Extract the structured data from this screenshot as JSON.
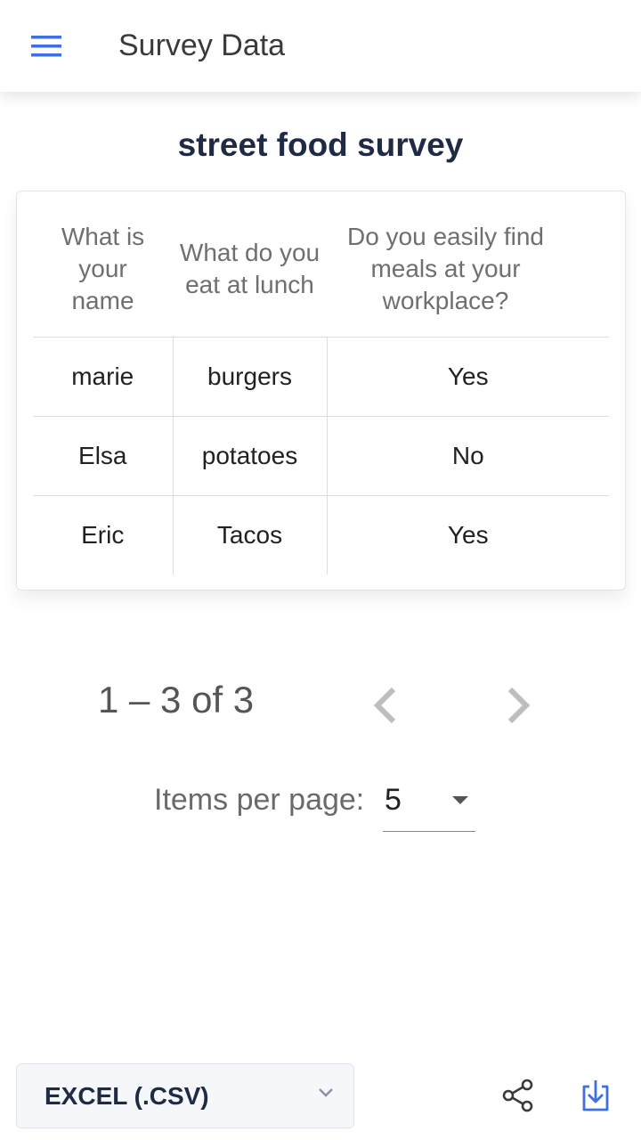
{
  "appbar": {
    "title": "Survey Data",
    "menu_icon": "menu-icon",
    "accent_color": "#3f6fe0"
  },
  "survey": {
    "title": "street food survey"
  },
  "table": {
    "headers": [
      "What is your name",
      "What do you eat at lunch",
      "Do you easily find meals at your workplace?"
    ],
    "rows": [
      [
        "marie",
        "burgers",
        "Yes"
      ],
      [
        "Elsa",
        "potatoes",
        "No"
      ],
      [
        "Eric",
        "Tacos",
        "Yes"
      ]
    ]
  },
  "paginator": {
    "range_label": "1 – 3 of 3",
    "items_per_page_label": "Items per page:",
    "items_per_page_value": "5",
    "prev_icon": "chevron-left-icon",
    "next_icon": "chevron-right-icon"
  },
  "export": {
    "format_value": "EXCEL (.CSV)",
    "chevron_icon": "chevron-down-icon",
    "share_icon": "share-icon",
    "download_icon": "download-icon"
  }
}
